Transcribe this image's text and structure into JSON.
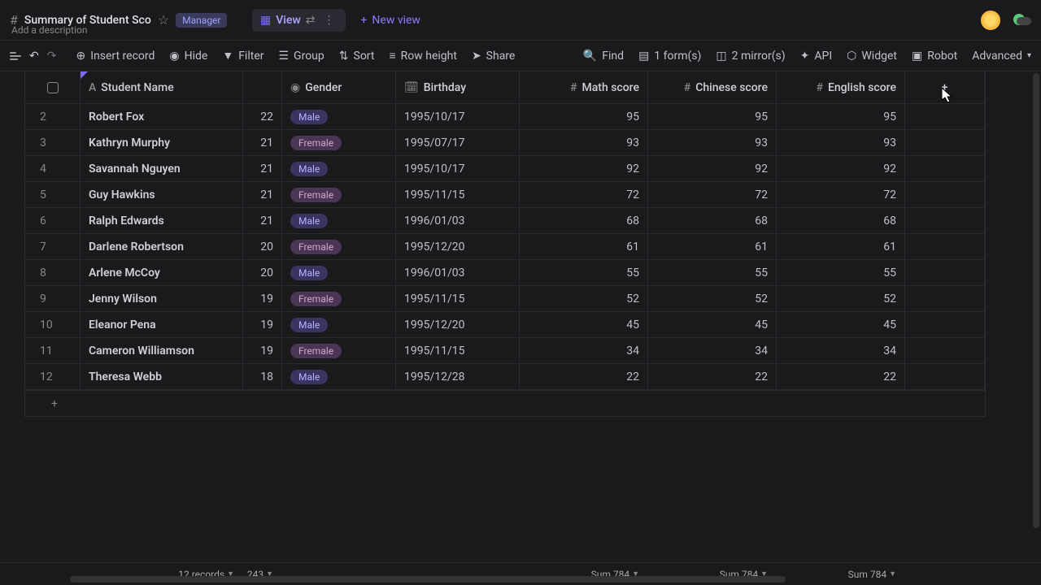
{
  "header": {
    "title": "Summary of Student Sco",
    "manager_badge": "Manager",
    "description": "Add a description",
    "view_label": "View",
    "new_view_label": "New view"
  },
  "toolbar": {
    "insert": "Insert record",
    "hide": "Hide",
    "filter": "Filter",
    "group": "Group",
    "sort": "Sort",
    "row_height": "Row height",
    "share": "Share",
    "find": "Find",
    "forms": "1 form(s)",
    "mirrors": "2 mirror(s)",
    "api": "API",
    "widget": "Widget",
    "robot": "Robot",
    "advanced": "Advanced"
  },
  "columns": {
    "name": "Student Name",
    "gender": "Gender",
    "birthday": "Birthday",
    "math": "Math score",
    "chinese": "Chinese score",
    "english": "English score"
  },
  "rows": [
    {
      "idx": "2",
      "name": "Robert Fox",
      "age": "22",
      "gender": "Male",
      "birthday": "1995/10/17",
      "math": "95",
      "chinese": "95",
      "english": "95"
    },
    {
      "idx": "3",
      "name": "Kathryn Murphy",
      "age": "21",
      "gender": "Fremale",
      "birthday": "1995/07/17",
      "math": "93",
      "chinese": "93",
      "english": "93"
    },
    {
      "idx": "4",
      "name": "Savannah Nguyen",
      "age": "21",
      "gender": "Male",
      "birthday": "1995/10/17",
      "math": "92",
      "chinese": "92",
      "english": "92"
    },
    {
      "idx": "5",
      "name": "Guy Hawkins",
      "age": "21",
      "gender": "Fremale",
      "birthday": "1995/11/15",
      "math": "72",
      "chinese": "72",
      "english": "72"
    },
    {
      "idx": "6",
      "name": "Ralph Edwards",
      "age": "21",
      "gender": "Male",
      "birthday": "1996/01/03",
      "math": "68",
      "chinese": "68",
      "english": "68"
    },
    {
      "idx": "7",
      "name": "Darlene Robertson",
      "age": "20",
      "gender": "Fremale",
      "birthday": "1995/12/20",
      "math": "61",
      "chinese": "61",
      "english": "61"
    },
    {
      "idx": "8",
      "name": "Arlene McCoy",
      "age": "20",
      "gender": "Male",
      "birthday": "1996/01/03",
      "math": "55",
      "chinese": "55",
      "english": "55"
    },
    {
      "idx": "9",
      "name": "Jenny Wilson",
      "age": "19",
      "gender": "Fremale",
      "birthday": "1995/11/15",
      "math": "52",
      "chinese": "52",
      "english": "52"
    },
    {
      "idx": "10",
      "name": "Eleanor Pena",
      "age": "19",
      "gender": "Male",
      "birthday": "1995/12/20",
      "math": "45",
      "chinese": "45",
      "english": "45"
    },
    {
      "idx": "11",
      "name": "Cameron Williamson",
      "age": "19",
      "gender": "Fremale",
      "birthday": "1995/11/15",
      "math": "34",
      "chinese": "34",
      "english": "34"
    },
    {
      "idx": "12",
      "name": "Theresa Webb",
      "age": "18",
      "gender": "Male",
      "birthday": "1995/12/28",
      "math": "22",
      "chinese": "22",
      "english": "22"
    }
  ],
  "footer": {
    "records": "12 records",
    "age_sum": "243",
    "math_sum": "Sum 784",
    "chinese_sum": "Sum 784",
    "english_sum": "Sum 784"
  }
}
